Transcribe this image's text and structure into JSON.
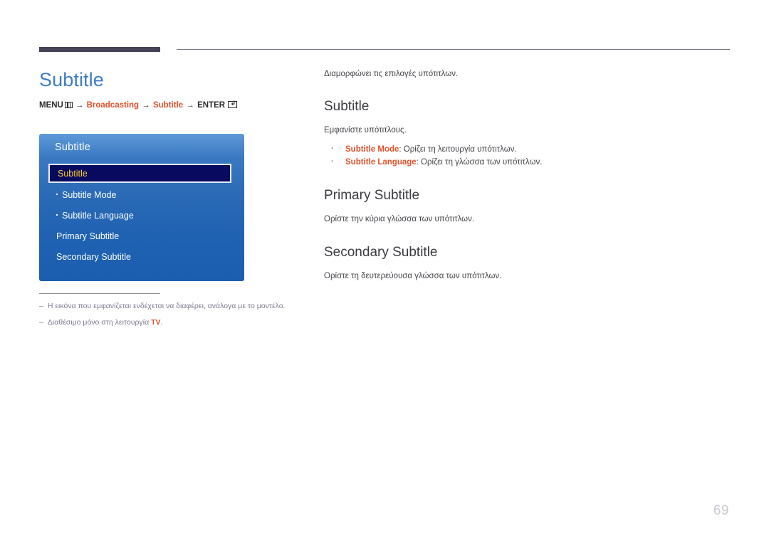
{
  "header": {
    "rule_color": "#474357"
  },
  "left": {
    "page_title": "Subtitle",
    "menu_path": {
      "menu_label": "MENU",
      "menu_icon": "menu-grid-icon",
      "arrow": "→",
      "item1": "Broadcasting",
      "item2": "Subtitle",
      "enter_label": "ENTER",
      "enter_icon": "enter-return-icon",
      "accent_color": "#e0512a"
    },
    "osd": {
      "title": "Subtitle",
      "selected_index": 0,
      "selected_text_color": "#ffd02e",
      "selected_bg_color": "#070a5e",
      "items": [
        {
          "label": "Subtitle",
          "sub": false,
          "selected": true
        },
        {
          "label": "Subtitle Mode",
          "sub": true,
          "selected": false
        },
        {
          "label": "Subtitle Language",
          "sub": true,
          "selected": false
        },
        {
          "label": "Primary Subtitle",
          "sub": false,
          "selected": false
        },
        {
          "label": "Secondary Subtitle",
          "sub": false,
          "selected": false
        }
      ]
    },
    "notes": [
      {
        "dash": "–",
        "text": "Η εικόνα που εμφανίζεται ενδέχεται να διαφέρει, ανάλογα με το μοντέλο.",
        "highlight": "",
        "tail": ""
      },
      {
        "dash": "–",
        "text": "Διαθέσιμο μόνο στη λειτουργία ",
        "highlight": "TV",
        "tail": "."
      }
    ]
  },
  "right": {
    "intro": "Διαμορφώνει τις επιλογές υπότιτλων.",
    "sections": [
      {
        "heading": "Subtitle",
        "body": "Εμφανίστε υπότιτλους.",
        "bullets": [
          {
            "term": "Subtitle Mode",
            "desc": ": Ορίζει τη λειτουργία υπότιτλων."
          },
          {
            "term": "Subtitle Language",
            "desc": ": Ορίζει τη γλώσσα των υπότιτλων."
          }
        ]
      },
      {
        "heading": "Primary Subtitle",
        "body": "Ορίστε την κύρια γλώσσα των υπότιτλων.",
        "bullets": []
      },
      {
        "heading": "Secondary Subtitle",
        "body": "Ορίστε τη δευτερεύουσα γλώσσα των υπότιτλων.",
        "bullets": []
      }
    ]
  },
  "footer": {
    "page_number": "69"
  }
}
